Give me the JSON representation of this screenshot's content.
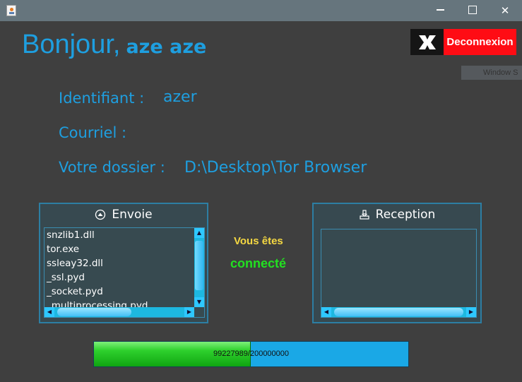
{
  "window": {
    "minimize_glyph": "",
    "close_glyph": "✕"
  },
  "header": {
    "greeting": "Bonjour,",
    "user_name": "aze aze",
    "logout_label": "Deconnexion",
    "ghost_label": "Window S"
  },
  "profile": {
    "id_label": "Identifiant :",
    "id_value": "azer",
    "email_label": "Courriel :",
    "email_value": "",
    "folder_label": "Votre dossier :",
    "folder_value": "D:\\Desktop\\Tor Browser"
  },
  "send_panel": {
    "title": "Envoie",
    "icon": "upload-circle-icon",
    "files": [
      "snzlib1.dll",
      "tor.exe",
      "ssleay32.dll",
      "_ssl.pyd",
      "_socket.pyd",
      "_multiprocessing.pyd"
    ]
  },
  "receive_panel": {
    "title": "Reception",
    "icon": "download-tray-icon",
    "files": []
  },
  "status": {
    "line1": "Vous êtes",
    "line2": "connecté"
  },
  "progress": {
    "current": 99227989,
    "total": 200000000,
    "text": "99227989/200000000"
  },
  "colors": {
    "accent": "#1e9fe0",
    "logout_red": "#ff0c14",
    "status_yellow": "#f5d842",
    "status_green": "#22e021"
  }
}
